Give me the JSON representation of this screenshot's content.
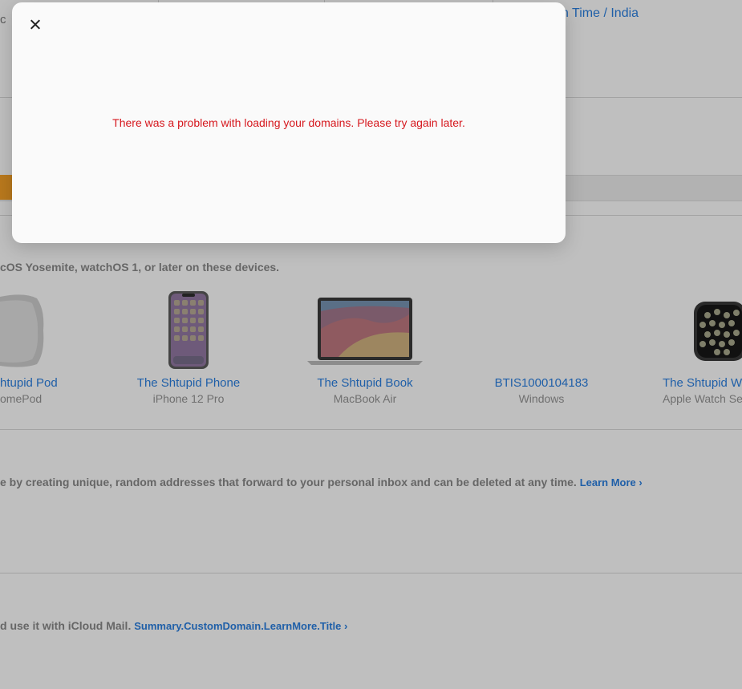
{
  "background": {
    "top_fragment": "c",
    "timezone": "n Time / India",
    "devices_text": "cOS Yosemite, watchOS 1, or later on these devices.",
    "devices": [
      {
        "name": "htupid Pod",
        "model": "omePod"
      },
      {
        "name": "The Shtupid Phone",
        "model": "iPhone 12 Pro"
      },
      {
        "name": "The Shtupid Book",
        "model": "MacBook Air"
      },
      {
        "name": "BTIS1000104183",
        "model": "Windows"
      },
      {
        "name": "The Shtupid W",
        "model": "Apple Watch Se"
      }
    ],
    "hide_email_text": "e by creating unique, random addresses that forward to your personal inbox and can be deleted at any time.",
    "hide_email_link": "Learn More ›",
    "custom_domain_text": "d use it with iCloud Mail.",
    "custom_domain_link": "Summary.CustomDomain.LearnMore.Title ›"
  },
  "modal": {
    "error": "There was a problem with loading your domains. Please try again later."
  },
  "colors": {
    "overlay": "#bfbfbf",
    "modal_bg": "#fafafa",
    "error": "#d6181e",
    "link": "#1f5fa8",
    "accent_orange": "#b9791d"
  },
  "icons": {
    "close": "close-icon",
    "homepod": "homepod-icon",
    "iphone": "iphone-icon",
    "macbook": "macbook-icon",
    "watch": "watch-icon"
  }
}
